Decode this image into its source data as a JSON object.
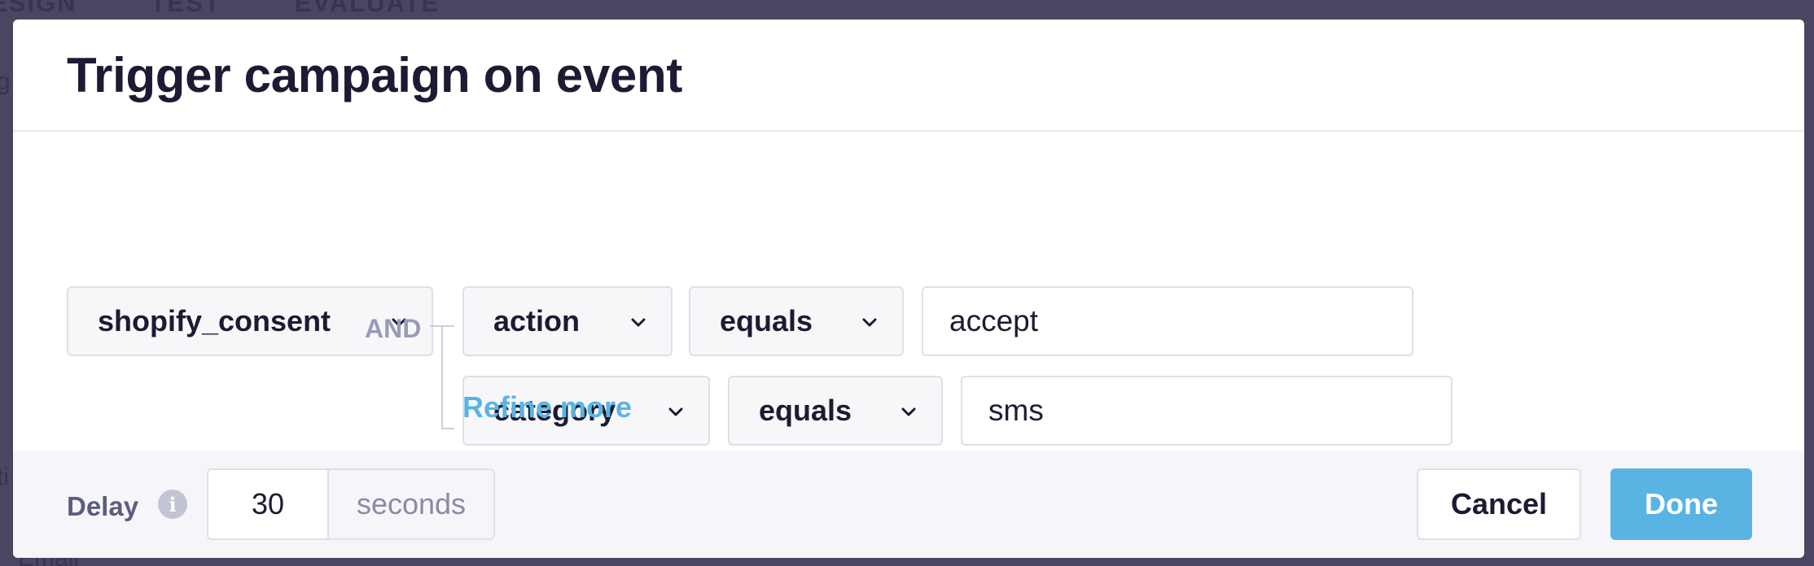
{
  "background": {
    "tabs": [
      "ESIGN",
      "TEST",
      "EVALUATE"
    ],
    "side_text_1": "g",
    "side_text_2": "ti",
    "bottom_text": "Email"
  },
  "modal": {
    "title": "Trigger campaign on event",
    "event_select": "shopify_consent",
    "conditions": [
      {
        "property": "action",
        "operator": "equals",
        "value": "accept"
      },
      {
        "property": "category",
        "operator": "equals",
        "value": "sms"
      }
    ],
    "connector_label": "AND",
    "refine_link": "Refine more"
  },
  "footer": {
    "delay_label": "Delay",
    "info_icon": "info-icon",
    "delay_value": "30",
    "delay_unit": "seconds",
    "cancel_label": "Cancel",
    "done_label": "Done"
  },
  "colors": {
    "accent": "#5ab4e3",
    "overlay": "#4a4560",
    "text": "#1c1b33"
  }
}
